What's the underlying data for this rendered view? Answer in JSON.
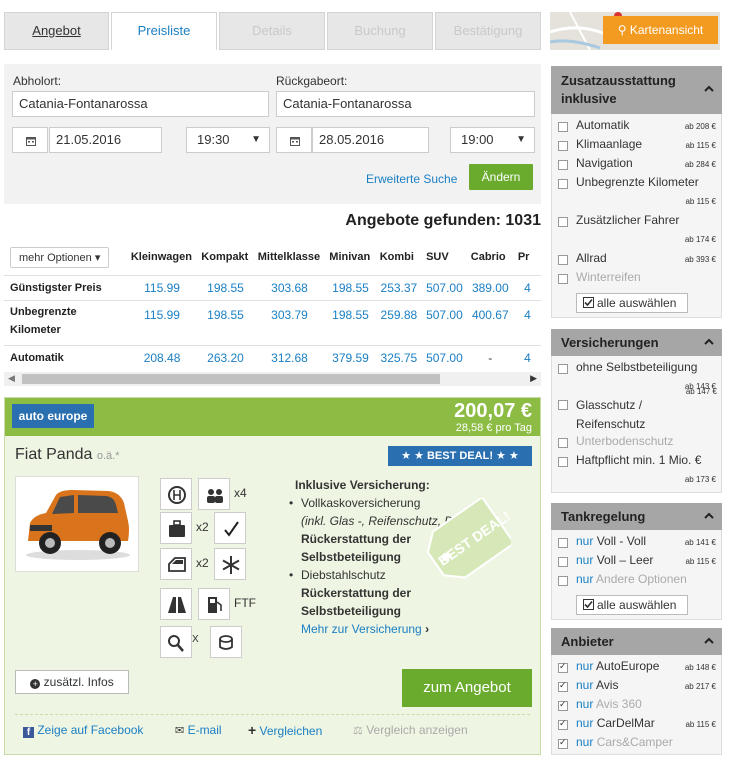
{
  "tabs": [
    {
      "label": "Angebot"
    },
    {
      "label": "Preisliste"
    },
    {
      "label": "Details"
    },
    {
      "label": "Buchung"
    },
    {
      "label": "Bestätigung"
    }
  ],
  "search": {
    "pickup_label": "Abholort:",
    "pickup_value": "Catania-Fontanarossa",
    "return_label": "Rückgabeort:",
    "return_value": "Catania-Fontanarossa",
    "pickup_date": "21.05.2016",
    "pickup_time": "19:30",
    "return_date": "28.05.2016",
    "return_time": "19:00",
    "advanced_link": "Erweiterte Suche",
    "change_button": "Ändern"
  },
  "results_count": "Angebote gefunden: 1031",
  "price_table": {
    "more_options": "mehr Optionen",
    "columns": [
      "Kleinwagen",
      "Kompakt",
      "Mittelklasse",
      "Minivan",
      "Kombi",
      "SUV",
      "Cabrio",
      "Pr"
    ],
    "rows": [
      {
        "label": "Günstigster Preis",
        "values": [
          "115.99",
          "198.55",
          "303.68",
          "198.55",
          "253.37",
          "507.00",
          "389.00",
          "4"
        ]
      },
      {
        "label": "Unbegrenzte Kilometer",
        "values": [
          "115.99",
          "198.55",
          "303.79",
          "198.55",
          "259.88",
          "507.00",
          "400.67",
          "4"
        ]
      },
      {
        "label": "Automatik",
        "values": [
          "208.48",
          "263.20",
          "312.68",
          "379.59",
          "325.75",
          "507.00",
          "-",
          "4"
        ]
      }
    ]
  },
  "offer": {
    "provider_logo": "auto europe",
    "price": "200,07 €",
    "per_day": "28,58 € pro Tag",
    "car_name": "Fiat Panda",
    "car_suffix": "o.ä.*",
    "best_deal": "★ ★ BEST DEAL! ★ ★",
    "badge_text": "BEST DEAL!",
    "features": {
      "persons": "x4",
      "bags": "x2",
      "doors": "x2",
      "fuel": "FTF",
      "km": "X"
    },
    "insurance_title": "Inklusive Versicherung:",
    "ins1": "Vollkaskoversicherung",
    "ins1_note": "(inkl. Glas -, Reifenschutz, Dach)",
    "ins1_sub": "Rückerstattung der Selbstbeteiligung",
    "ins2": "Diebstahlschutz",
    "ins2_sub": "Rückerstattung der Selbstbeteiligung",
    "more_insurance": "Mehr zur Versicherung",
    "more_info": "zusätzl. Infos",
    "cta": "zum Angebot",
    "share_facebook": "Zeige auf Facebook",
    "share_email": "E-mail",
    "compare": "Vergleichen",
    "compare_show": "Vergleich anzeigen"
  },
  "map": {
    "button": "Kartenansicht"
  },
  "extras": {
    "title": "Zusatzausstattung inklusive",
    "items": [
      {
        "label": "Automatik",
        "price": "ab 208 €"
      },
      {
        "label": "Klimaanlage",
        "price": "ab 115 €"
      },
      {
        "label": "Navigation",
        "price": "ab 284 €"
      },
      {
        "label": "Unbegrenzte Kilometer",
        "price": "ab 115 €"
      },
      {
        "label": "Zusätzlicher Fahrer",
        "price": "ab 174 €"
      },
      {
        "label": "Allrad",
        "price": "ab 393 €"
      },
      {
        "label": "Winterreifen",
        "price": ""
      }
    ],
    "select_all": "alle auswählen"
  },
  "insurance": {
    "title": "Versicherungen",
    "items": [
      {
        "label": "ohne Selbstbeteiligung",
        "price": "ab 143 €"
      },
      {
        "label": "Glasschutz / Reifenschutz",
        "price": "ab 147 €"
      },
      {
        "label": "Unterbodenschutz",
        "price": ""
      },
      {
        "label": "Haftpflicht min. 1 Mio. €",
        "price": "ab 173 €"
      }
    ]
  },
  "fuel": {
    "title": "Tankregelung",
    "nur": "nur",
    "items": [
      {
        "label": "Voll - Voll",
        "price": "ab 141 €"
      },
      {
        "label": "Voll – Leer",
        "price": "ab 115 €"
      },
      {
        "label": "Andere Optionen",
        "price": ""
      }
    ],
    "select_all": "alle auswählen"
  },
  "providers": {
    "title": "Anbieter",
    "nur": "nur",
    "items": [
      {
        "label": "AutoEurope",
        "price": "ab 148 €"
      },
      {
        "label": "Avis",
        "price": "ab 217 €"
      },
      {
        "label": "Avis 360",
        "price": ""
      },
      {
        "label": "CarDelMar",
        "price": "ab 115 €"
      },
      {
        "label": "Cars&Camper",
        "price": ""
      }
    ]
  }
}
